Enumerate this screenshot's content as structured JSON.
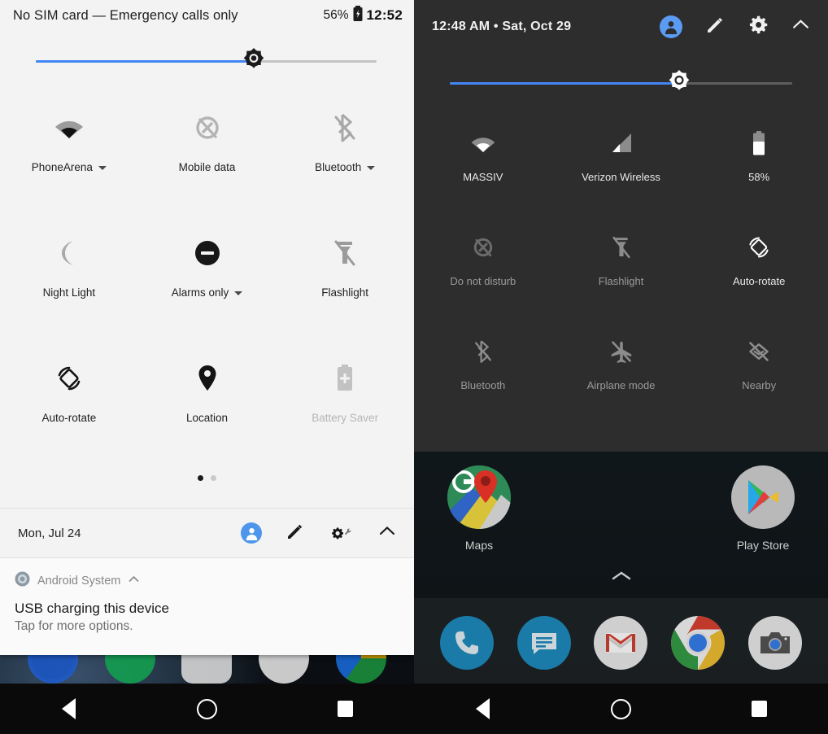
{
  "left_screen": {
    "status_bar": {
      "carrier_text": "No SIM card — Emergency calls only",
      "battery_percent": "56%",
      "battery_icon": "battery-charging-icon",
      "clock": "12:52"
    },
    "brightness": {
      "icon": "brightness-sun-icon",
      "value_percent": 60,
      "accent": "#4285f4"
    },
    "quick_settings": [
      {
        "icon": "wifi-icon",
        "label": "PhoneArena",
        "has_caret": true,
        "enabled": true
      },
      {
        "icon": "mobile-data-off-icon",
        "label": "Mobile data",
        "has_caret": false,
        "enabled": false
      },
      {
        "icon": "bluetooth-off-icon",
        "label": "Bluetooth",
        "has_caret": true,
        "enabled": false
      },
      {
        "icon": "night-light-moon-icon",
        "label": "Night Light",
        "has_caret": false,
        "enabled": false
      },
      {
        "icon": "do-not-disturb-icon",
        "label": "Alarms only",
        "has_caret": true,
        "enabled": true
      },
      {
        "icon": "flashlight-off-icon",
        "label": "Flashlight",
        "has_caret": false,
        "enabled": false
      },
      {
        "icon": "auto-rotate-icon",
        "label": "Auto-rotate",
        "has_caret": false,
        "enabled": true
      },
      {
        "icon": "location-pin-icon",
        "label": "Location",
        "has_caret": false,
        "enabled": true
      },
      {
        "icon": "battery-saver-icon",
        "label": "Battery Saver",
        "has_caret": false,
        "enabled": false
      }
    ],
    "pagination": {
      "pages": 2,
      "active_index": 0
    },
    "footer": {
      "date": "Mon, Jul 24",
      "avatar_icon": "user-avatar-icon",
      "avatar_color": "#4e96ec",
      "edit_icon": "pencil-edit-icon",
      "settings_icon": "gear-wrench-icon",
      "collapse_icon": "chevron-up-icon"
    },
    "notification": {
      "app_icon": "android-system-icon",
      "app_name": "Android System",
      "expand_icon": "chevron-up-icon",
      "title": "USB charging this device",
      "subtitle": "Tap for more options."
    },
    "nav_bar": {
      "back": "back-triangle-icon",
      "home": "home-circle-icon",
      "recents": "recents-square-icon"
    }
  },
  "right_screen": {
    "header": {
      "time_and_date": "12:48 AM  •  Sat, Oct 29",
      "avatar_icon": "user-avatar-icon",
      "avatar_color": "#5b9bf3",
      "edit_icon": "pencil-edit-icon",
      "settings_icon": "gear-icon",
      "collapse_icon": "chevron-up-icon"
    },
    "brightness": {
      "icon": "brightness-sun-icon",
      "value_percent": 66,
      "accent": "#4285f4"
    },
    "quick_settings": [
      {
        "icon": "wifi-icon",
        "label": "MASSIV",
        "enabled": true
      },
      {
        "icon": "cellular-signal-icon",
        "label": "Verizon Wireless",
        "enabled": true
      },
      {
        "icon": "battery-icon",
        "label": "58%",
        "enabled": true
      },
      {
        "icon": "do-not-disturb-off-icon",
        "label": "Do not disturb",
        "enabled": false
      },
      {
        "icon": "flashlight-off-icon",
        "label": "Flashlight",
        "enabled": false
      },
      {
        "icon": "auto-rotate-icon",
        "label": "Auto-rotate",
        "enabled": true
      },
      {
        "icon": "bluetooth-off-icon",
        "label": "Bluetooth",
        "enabled": false
      },
      {
        "icon": "airplane-mode-off-icon",
        "label": "Airplane mode",
        "enabled": false
      },
      {
        "icon": "nearby-off-icon",
        "label": "Nearby",
        "enabled": false
      }
    ],
    "home_apps": [
      {
        "icon": "google-maps-icon",
        "label": "Maps"
      },
      {
        "icon": "google-play-store-icon",
        "label": "Play Store"
      }
    ],
    "drawer_handle_icon": "chevron-up-icon",
    "dock": [
      {
        "icon": "phone-icon"
      },
      {
        "icon": "messages-icon"
      },
      {
        "icon": "gmail-icon"
      },
      {
        "icon": "chrome-icon"
      },
      {
        "icon": "camera-icon"
      }
    ],
    "nav_bar": {
      "back": "back-triangle-icon",
      "home": "home-circle-icon",
      "recents": "recents-square-icon"
    }
  }
}
